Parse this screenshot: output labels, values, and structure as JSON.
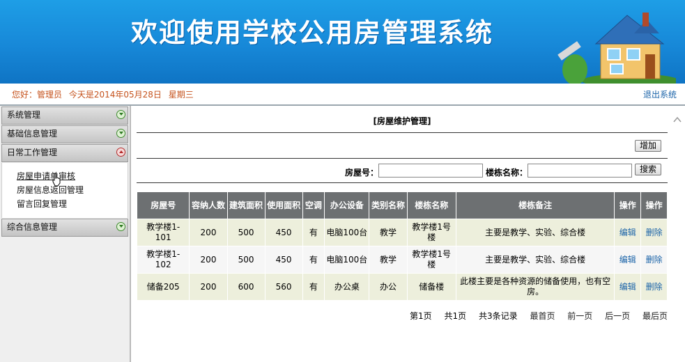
{
  "banner": {
    "title": "欢迎使用学校公用房管理系统"
  },
  "status": {
    "greeting": "您好：管理员",
    "date_text": "今天是2014年05月28日",
    "weekday": "星期三",
    "logout": "退出系统"
  },
  "sidebar": {
    "sections": [
      {
        "label": "系统管理",
        "expanded": false
      },
      {
        "label": "基础信息管理",
        "expanded": false
      },
      {
        "label": "日常工作管理",
        "expanded": true
      },
      {
        "label": "综合信息管理",
        "expanded": false
      }
    ],
    "daily_items": [
      "房屋申请单审核",
      "房屋信息返回管理",
      "留言回复管理"
    ]
  },
  "page": {
    "title": "[房屋维护管理]",
    "add_label": "增加",
    "search": {
      "room_label": "房屋号：",
      "building_label": "楼栋名称：",
      "button": "搜索",
      "room_value": "",
      "building_value": ""
    }
  },
  "table": {
    "headers": [
      "房屋号",
      "容纳人数",
      "建筑面积",
      "使用面积",
      "空调",
      "办公设备",
      "类别名称",
      "楼栋名称",
      "楼栋备注",
      "操作",
      "操作"
    ],
    "rows": [
      [
        "教学楼1-101",
        "200",
        "500",
        "450",
        "有",
        "电脑100台",
        "教学",
        "教学楼1号楼",
        "主要是教学、实验、综合楼",
        "编辑",
        "删除"
      ],
      [
        "教学楼1-102",
        "200",
        "500",
        "450",
        "有",
        "电脑100台",
        "教学",
        "教学楼1号楼",
        "主要是教学、实验、综合楼",
        "编辑",
        "删除"
      ],
      [
        "储备205",
        "200",
        "600",
        "560",
        "有",
        "办公桌",
        "办公",
        "储备楼",
        "此楼主要是各种资源的储备使用，也有空房。",
        "编辑",
        "删除"
      ]
    ]
  },
  "pager": {
    "current": "第1页",
    "total_pages": "共1页",
    "total_records": "共3条记录",
    "first": "最首页",
    "prev": "前一页",
    "next": "后一页",
    "last": "最后页"
  },
  "colors": {
    "banner": "#1788d8",
    "header_row": "#6d7072",
    "row_odd": "#edefdc",
    "link": "#1a63a8",
    "greeting": "#c5521c"
  }
}
